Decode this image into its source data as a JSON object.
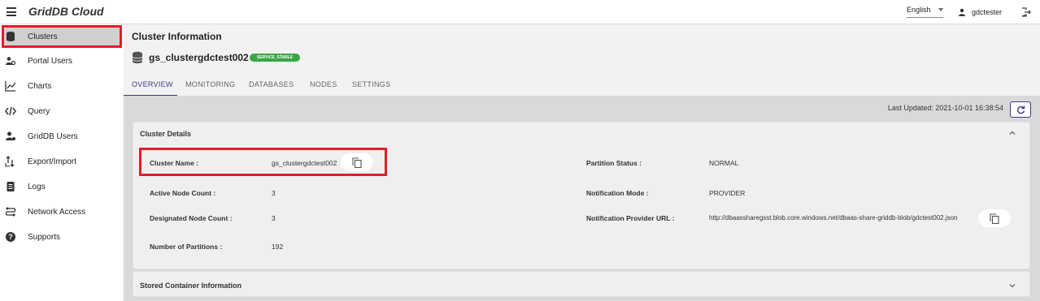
{
  "app": {
    "brand": "GridDB Cloud"
  },
  "header": {
    "language": "English",
    "username": "gdctester"
  },
  "sidebar": {
    "items": [
      {
        "label": "Clusters",
        "icon": "database-icon"
      },
      {
        "label": "Portal Users",
        "icon": "users-icon"
      },
      {
        "label": "Charts",
        "icon": "chart-line-icon"
      },
      {
        "label": "Query",
        "icon": "code-icon"
      },
      {
        "label": "GridDB Users",
        "icon": "user-gear-icon"
      },
      {
        "label": "Export/Import",
        "icon": "export-import-icon"
      },
      {
        "label": "Logs",
        "icon": "logs-icon"
      },
      {
        "label": "Network Access",
        "icon": "network-icon"
      },
      {
        "label": "Supports",
        "icon": "help-icon"
      }
    ]
  },
  "main": {
    "page_title": "Cluster Information",
    "cluster_name": "gs_clustergdctest002",
    "status_badge": "SERVICE_STABLE",
    "tabs": [
      "OVERVIEW",
      "MONITORING",
      "DATABASES",
      "NODES",
      "SETTINGS"
    ],
    "last_updated": "Last Updated: 2021-10-01 16:38:54"
  },
  "cluster_details": {
    "title": "Cluster Details",
    "cluster_name_label": "Cluster Name :",
    "cluster_name_value": "gs_clustergdctest002",
    "active_node_count_label": "Active Node Count :",
    "active_node_count_value": "3",
    "designated_node_count_label": "Designated Node Count :",
    "designated_node_count_value": "3",
    "number_of_partitions_label": "Number of Partitions :",
    "number_of_partitions_value": "192",
    "partition_status_label": "Partition Status :",
    "partition_status_value": "NORMAL",
    "notification_mode_label": "Notification Mode :",
    "notification_mode_value": "PROVIDER",
    "notification_provider_url_label": "Notification Provider URL :",
    "notification_provider_url_value": "http://dbaassharegsst.blob.core.windows.net/dbaas-share-griddb-blob/gdctest002.json"
  },
  "stored_container": {
    "title": "Stored Container Information"
  },
  "colors": {
    "accent": "#3d3a86",
    "highlight": "#e01e2a",
    "badge": "#3aa744"
  }
}
